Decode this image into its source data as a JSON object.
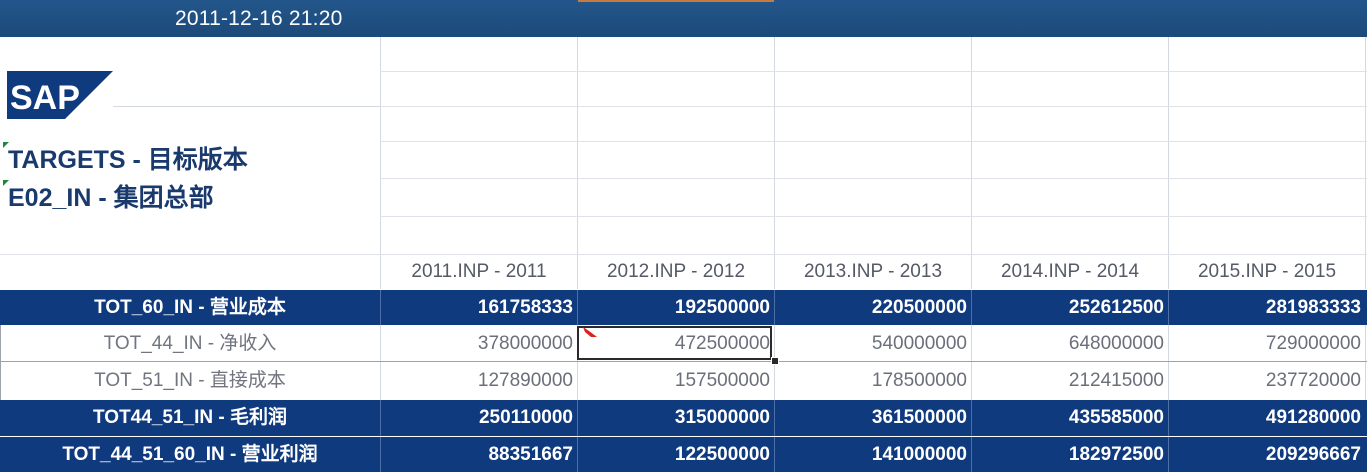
{
  "header": {
    "timestamp": "2011-12-16 21:20"
  },
  "logo": {
    "text": "SAP",
    "color": "#0f3a7e"
  },
  "report": {
    "version_title": "TARGETS - 目标版本",
    "entity_title": "E02_IN - 集团总部"
  },
  "columns": [
    "2011.INP - 2011",
    "2012.INP - 2012",
    "2013.INP - 2013",
    "2014.INP - 2014",
    "2015.INP - 2015"
  ],
  "rows": [
    {
      "label": "TOT_60_IN - 营业成本",
      "style": "bold",
      "values": [
        "161758333",
        "192500000",
        "220500000",
        "252612500",
        "281983333"
      ]
    },
    {
      "label": "TOT_44_IN - 净收入",
      "style": "plain",
      "values": [
        "378000000",
        "472500000",
        "540000000",
        "648000000",
        "729000000"
      ]
    },
    {
      "label": "TOT_51_IN - 直接成本",
      "style": "plain",
      "values": [
        "127890000",
        "157500000",
        "178500000",
        "212415000",
        "237720000"
      ]
    },
    {
      "label": "TOT44_51_IN - 毛利润",
      "style": "bold",
      "values": [
        "250110000",
        "315000000",
        "361500000",
        "435585000",
        "491280000"
      ]
    },
    {
      "label": "TOT_44_51_60_IN - 营业利润",
      "style": "bold",
      "values": [
        "88351667",
        "122500000",
        "141000000",
        "182972500",
        "209296667"
      ]
    }
  ],
  "colors": {
    "header_bar": "#1f4e79",
    "total_row": "#0f3a7e",
    "title_text": "#1a3a6e",
    "comment_indicator": "#e0201b"
  }
}
